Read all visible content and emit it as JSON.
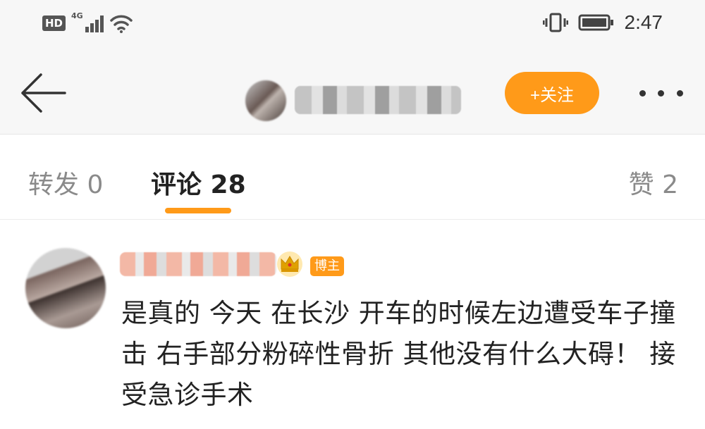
{
  "status_bar": {
    "hd_label": "HD",
    "network_label": "4G",
    "time": "2:47",
    "icons": [
      "hd-icon",
      "signal-icon",
      "wifi-icon",
      "vibrate-icon",
      "battery-icon"
    ]
  },
  "nav": {
    "back_icon": "back-arrow-icon",
    "follow_label": "+关注",
    "more_icon": "more-dots-icon"
  },
  "tabs": [
    {
      "label": "转发 0"
    },
    {
      "label": "评论 28"
    },
    {
      "label": "赞 2"
    }
  ],
  "comment": {
    "badge": "博主",
    "crown_icon": "crown-icon",
    "text": "是真的 今天 在长沙 开车的时候左边遭受车子撞击 右手部分粉碎性骨折 其他没有什么大碍！ 接受急诊手术"
  },
  "colors": {
    "accent": "#ff9a19",
    "bar_bg": "#f7f7f7",
    "text_primary": "#222222",
    "text_secondary": "#8a8a8a"
  }
}
